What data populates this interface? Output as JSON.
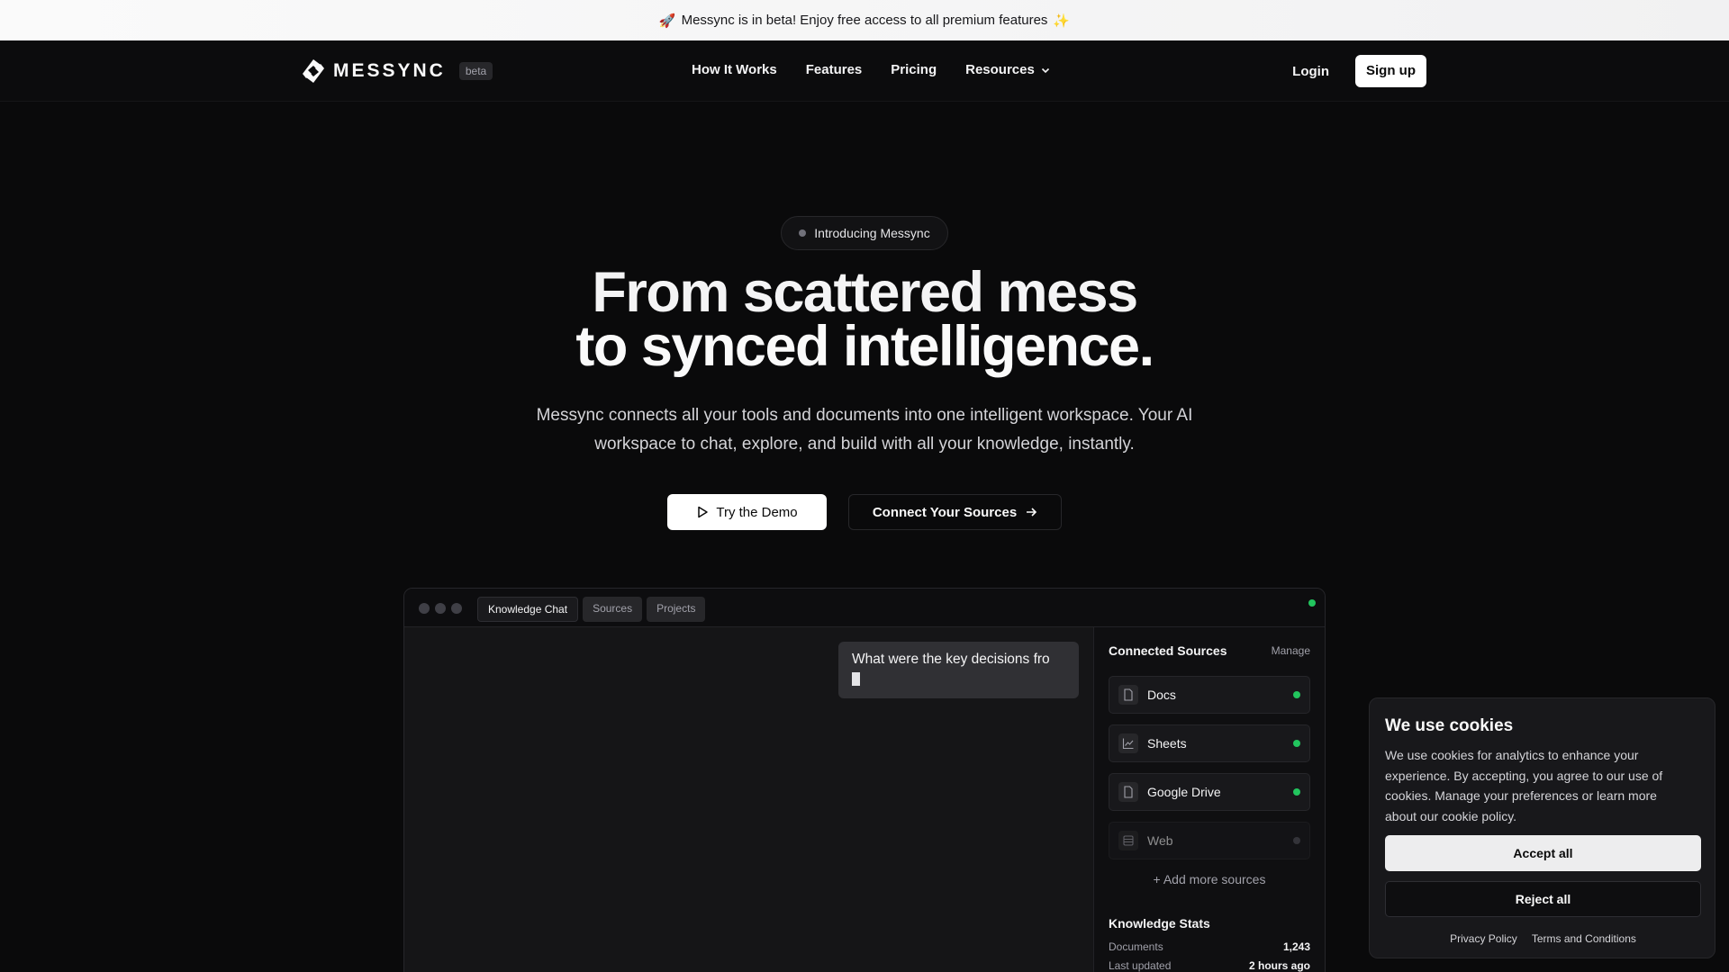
{
  "announcement": {
    "rocket_emoji": "🚀",
    "text": "Messync is in beta! Enjoy free access to all premium features",
    "sparkle_emoji": "✨"
  },
  "nav": {
    "logo_text": "MESSYNC",
    "beta_badge": "beta",
    "links": [
      "How It Works",
      "Features",
      "Pricing",
      "Resources"
    ],
    "login": "Login",
    "signup": "Sign up"
  },
  "hero": {
    "pill": "Introducing Messync",
    "headline_line1": "From scattered mess",
    "headline_line2": "to synced intelligence.",
    "subtitle": "Messync connects all your tools and documents into one intelligent workspace. Your AI workspace to chat, explore, and build with all your knowledge, instantly.",
    "cta_demo": "Try the Demo",
    "cta_connect": "Connect Your Sources"
  },
  "app": {
    "tabs": [
      "Knowledge Chat",
      "Sources",
      "Projects"
    ],
    "active_tab": "Knowledge Chat",
    "chat_message": "What were the key decisions fro",
    "sidebar": {
      "title": "Connected Sources",
      "manage": "Manage",
      "sources": [
        {
          "label": "Docs",
          "icon": "document-icon",
          "connected": true
        },
        {
          "label": "Sheets",
          "icon": "chart-icon",
          "connected": true
        },
        {
          "label": "Google Drive",
          "icon": "document-icon",
          "connected": true
        },
        {
          "label": "Web",
          "icon": "database-icon",
          "connected": false
        }
      ],
      "add_more": "+ Add more sources",
      "stats_title": "Knowledge Stats",
      "stats": [
        {
          "label": "Documents",
          "value": "1,243"
        },
        {
          "label": "Last updated",
          "value": "2 hours ago"
        }
      ]
    }
  },
  "cookie": {
    "title": "We use cookies",
    "body": "We use cookies for analytics to enhance your experience. By accepting, you agree to our use of cookies. Manage your preferences or learn more about our cookie policy.",
    "accept": "Accept all",
    "reject": "Reject all",
    "privacy": "Privacy Policy",
    "terms": "Terms and Conditions"
  },
  "colors": {
    "background": "#0a0a0b",
    "accent_green": "#22c55e",
    "button_white": "#ffffff"
  }
}
